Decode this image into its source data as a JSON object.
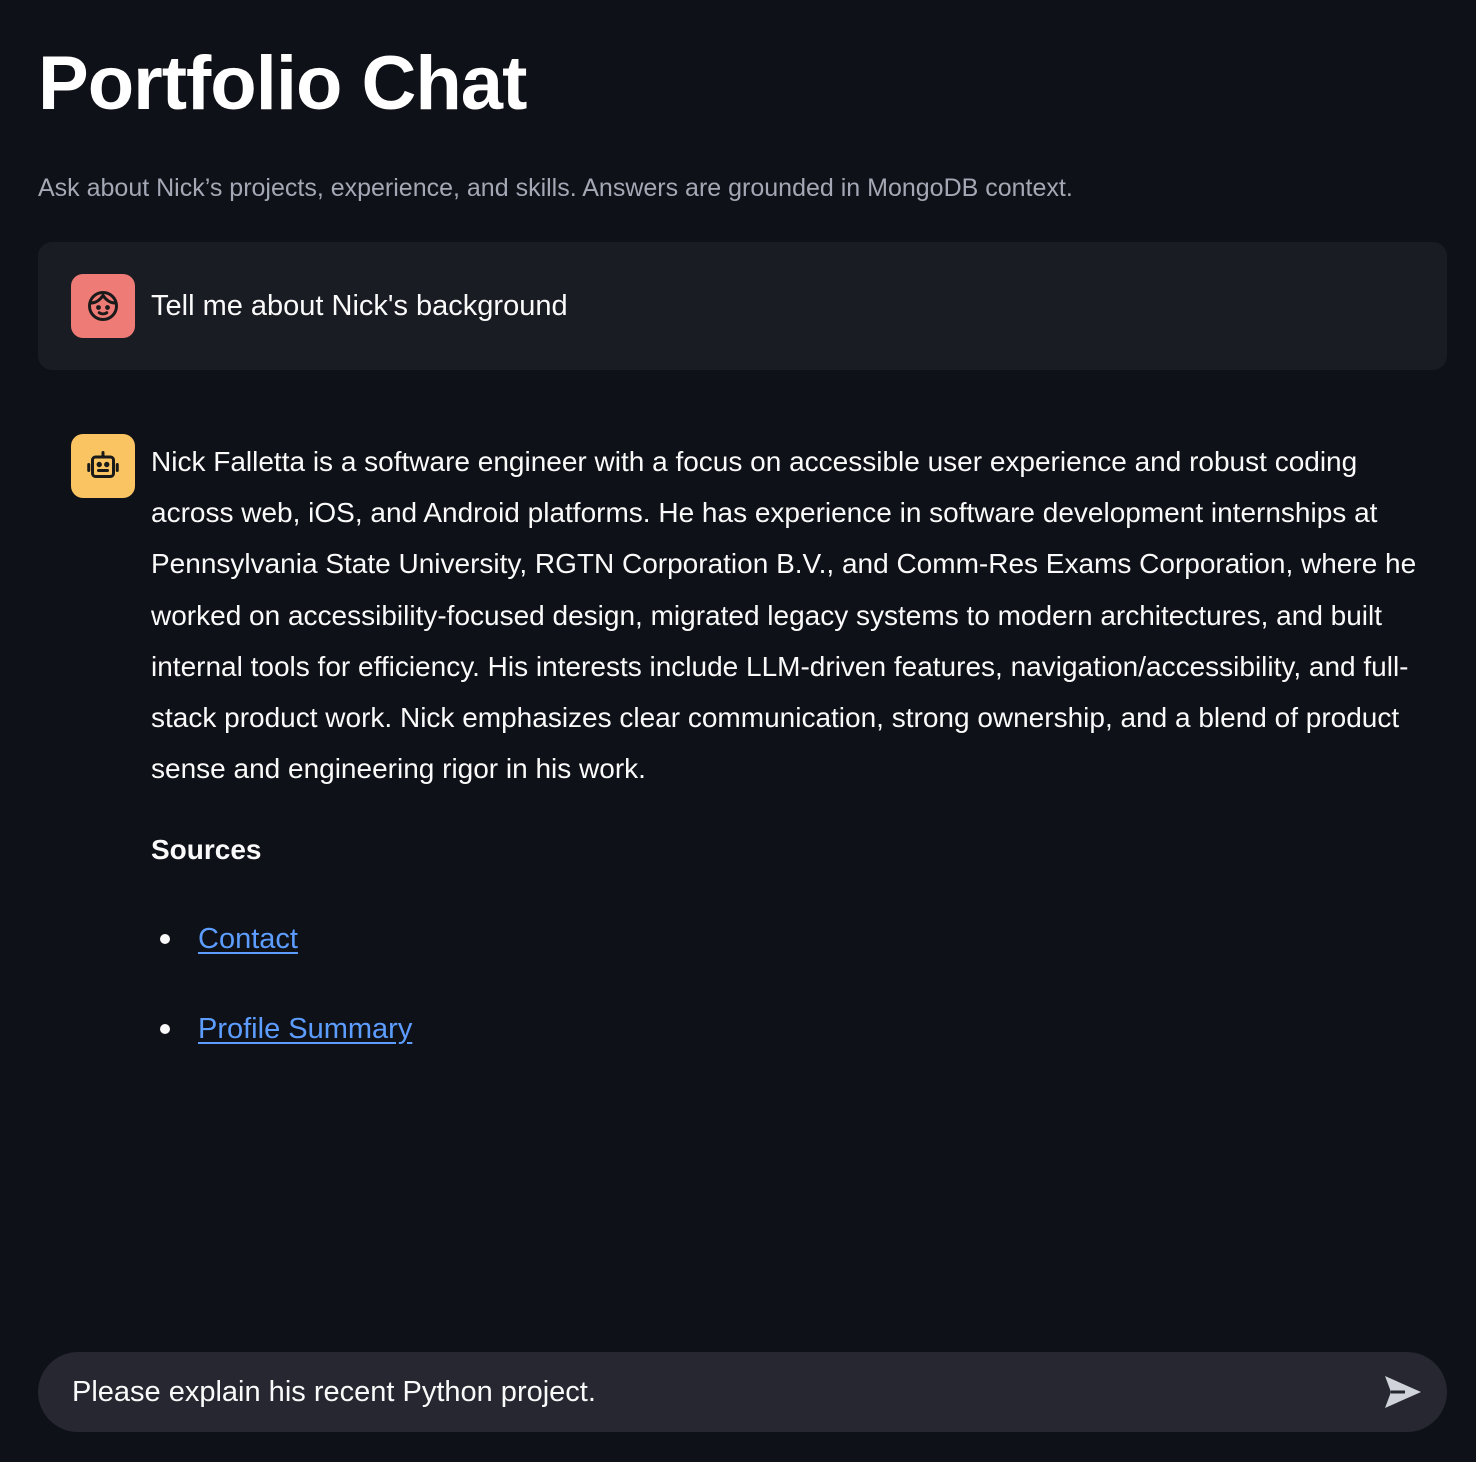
{
  "header": {
    "title": "Portfolio Chat",
    "subtitle": "Ask about Nick’s projects, experience, and skills. Answers are grounded in MongoDB context."
  },
  "messages": {
    "user": {
      "avatar_icon": "face-icon",
      "avatar_color": "#ef7b77",
      "text": "Tell me about Nick's background"
    },
    "assistant": {
      "avatar_icon": "robot-icon",
      "avatar_color": "#fbc462",
      "text": "Nick Falletta is a software engineer with a focus on accessible user experience and robust coding across web, iOS, and Android platforms. He has experience in software development internships at Pennsylvania State University, RGTN Corporation B.V., and Comm-Res Exams Corporation, where he worked on accessibility-focused design, migrated legacy systems to modern architectures, and built internal tools for efficiency. His interests include LLM-driven features, navigation/accessibility, and full-stack product work. Nick emphasizes clear communication, strong ownership, and a blend of product sense and engineering rigor in his work.",
      "sources_title": "Sources",
      "sources": [
        {
          "label": "Contact"
        },
        {
          "label": "Profile Summary"
        }
      ]
    }
  },
  "chat_input": {
    "value": "Please explain his recent Python project.",
    "send_icon": "send-icon"
  },
  "colors": {
    "background": "#0e1117",
    "user_bubble": "#1a1c24",
    "input_background": "#262730",
    "link": "#5c9dff"
  }
}
